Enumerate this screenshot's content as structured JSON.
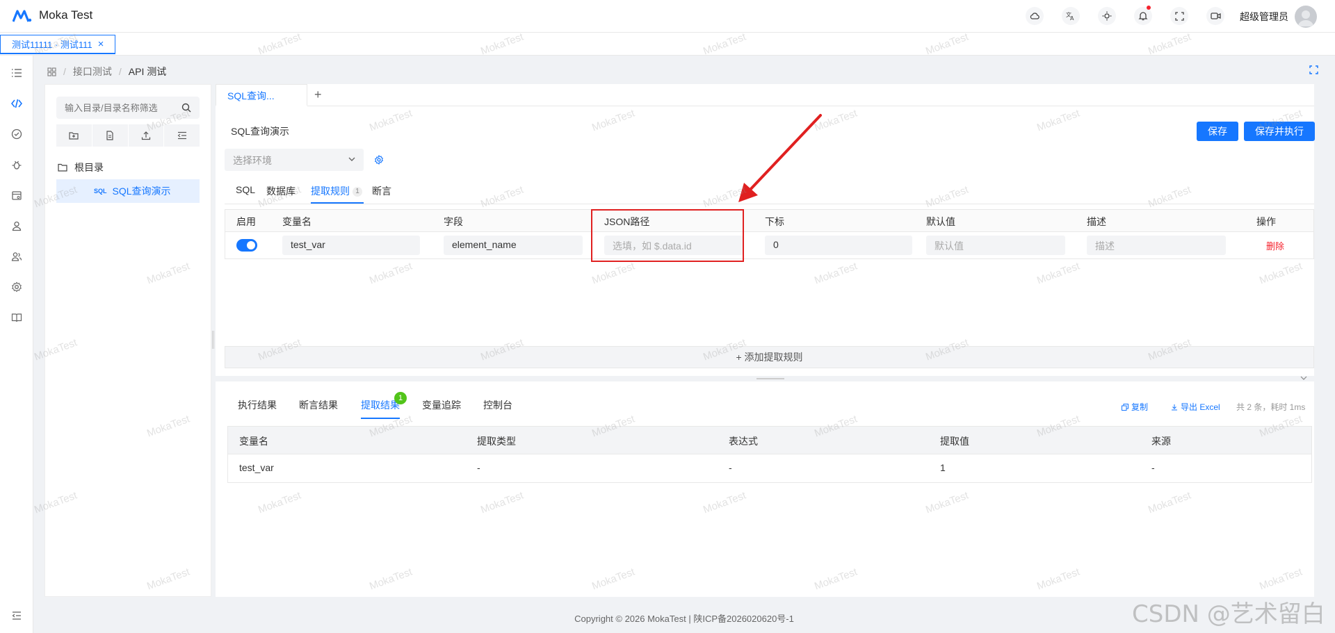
{
  "header": {
    "app_title": "Moka Test",
    "user_name": "超级管理员",
    "brand_color": "#1677ff"
  },
  "open_tab": {
    "label": "测试11111 · 测试111",
    "close": "×"
  },
  "breadcrumb": {
    "items": [
      "接口测试",
      "API 测试"
    ]
  },
  "tree": {
    "search_placeholder": "输入目录/目录名称筛选",
    "root_label": "根目录",
    "item_badge": "SQL",
    "item_label": "SQL查询演示"
  },
  "request": {
    "tab_label": "SQL查询...",
    "add_tab": "+",
    "name": "SQL查询演示",
    "save_label": "保存",
    "save_run_label": "保存并执行",
    "env_placeholder": "选择环境",
    "subtabs": [
      "SQL",
      "数据库",
      "提取规则",
      "断言"
    ],
    "subtab_badge": "1",
    "rules_columns": [
      "启用",
      "变量名",
      "字段",
      "JSON路径",
      "下标",
      "默认值",
      "描述",
      "操作"
    ],
    "rule_row": {
      "enabled": true,
      "var_name": "test_var",
      "field": "element_name",
      "json_path_placeholder": "选填，如 $.data.id",
      "index": "0",
      "default_placeholder": "默认值",
      "desc_placeholder": "描述",
      "delete_label": "删除"
    },
    "add_rule_label": "+ 添加提取规则"
  },
  "results": {
    "tabs": [
      "执行结果",
      "断言结果",
      "提取结果",
      "变量追踪",
      "控制台"
    ],
    "tab_badge": "1",
    "copy_label": "复制",
    "export_label": "导出 Excel",
    "summary": "共 2 条，耗时 1ms",
    "columns": [
      "变量名",
      "提取类型",
      "表达式",
      "提取值",
      "来源"
    ],
    "rows": [
      [
        "test_var",
        "-",
        "-",
        "1",
        "-"
      ]
    ]
  },
  "footer": {
    "text": "Copyright © 2026 MokaTest | 陕ICP备2026020620号-1"
  },
  "watermark": {
    "text": "MokaTest",
    "overlay": "CSDN @艺术留白"
  }
}
